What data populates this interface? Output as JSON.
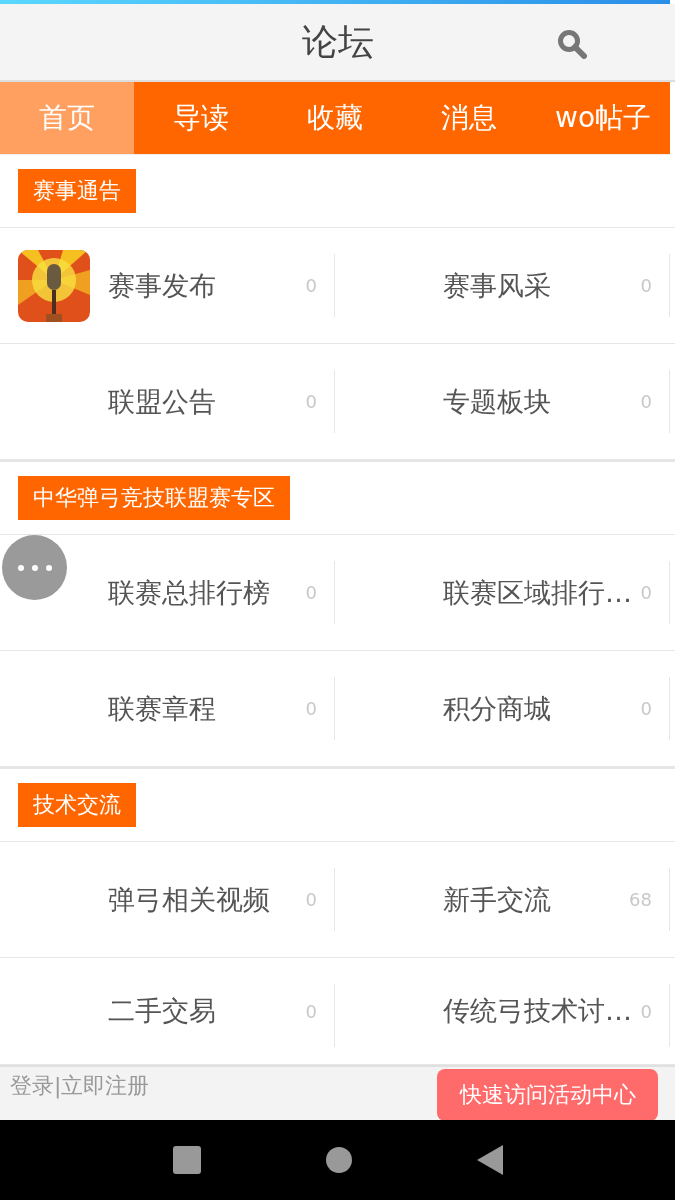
{
  "header": {
    "title": "论坛"
  },
  "tabs": [
    {
      "label": "首页",
      "selected": true
    },
    {
      "label": "导读",
      "selected": false
    },
    {
      "label": "收藏",
      "selected": false
    },
    {
      "label": "消息",
      "selected": false
    },
    {
      "label": "wo帖子",
      "selected": false
    }
  ],
  "sections": [
    {
      "title": "赛事通告",
      "boards": [
        {
          "name": "赛事发布",
          "count": "0",
          "kind": "picture"
        },
        {
          "name": "赛事风采",
          "count": "0"
        },
        {
          "name": "联盟公告",
          "count": "0"
        },
        {
          "name": "专题板块",
          "count": "0"
        }
      ]
    },
    {
      "title": "中华弹弓竞技联盟赛专区",
      "boards": [
        {
          "name": "联赛总排行榜",
          "count": "0"
        },
        {
          "name": "联赛区域排行…",
          "count": "0"
        },
        {
          "name": "联赛章程",
          "count": "0"
        },
        {
          "name": "积分商城",
          "count": "0"
        }
      ]
    },
    {
      "title": "技术交流",
      "boards": [
        {
          "name": "弹弓相关视频",
          "count": "0"
        },
        {
          "name": "新手交流",
          "count": "68"
        },
        {
          "name": "二手交易",
          "count": "0"
        },
        {
          "name": "传统弓技术讨…",
          "count": "0"
        }
      ]
    }
  ],
  "footer": {
    "login": "登录|立即注册",
    "activity_button": "快速访问活动中心"
  }
}
